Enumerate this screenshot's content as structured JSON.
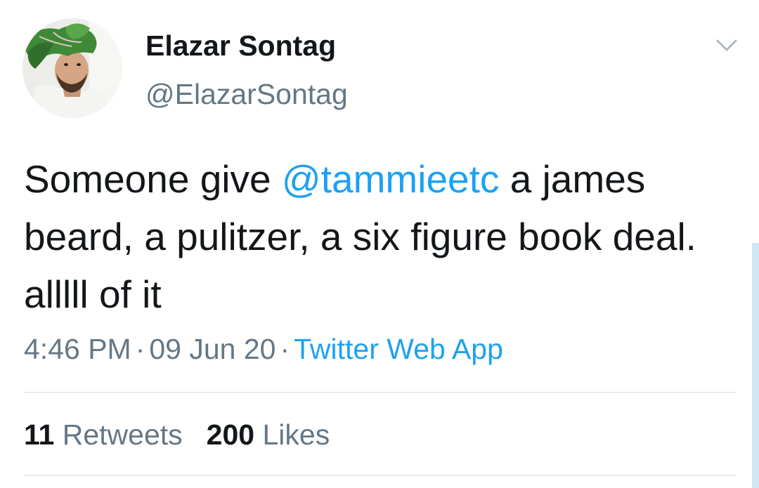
{
  "author": {
    "display_name": "Elazar Sontag",
    "handle": "@ElazarSontag",
    "avatar_icon": "profile-photo"
  },
  "tweet": {
    "text_before": "Someone give ",
    "mention": "@tammieetc",
    "text_after": " a james beard, a pulitzer, a six figure book deal. alllll of it"
  },
  "meta": {
    "time": "4:46 PM",
    "separator": "·",
    "date": "09 Jun 20",
    "source": "Twitter Web App"
  },
  "stats": {
    "retweets_count": "11",
    "retweets_label": "Retweets",
    "likes_count": "200",
    "likes_label": "Likes"
  },
  "colors": {
    "link": "#1da1f2",
    "secondary_text": "#657786",
    "primary_text": "#14171a",
    "divider": "#e6ecf0"
  },
  "icons": {
    "menu": "chevron-down-icon"
  }
}
